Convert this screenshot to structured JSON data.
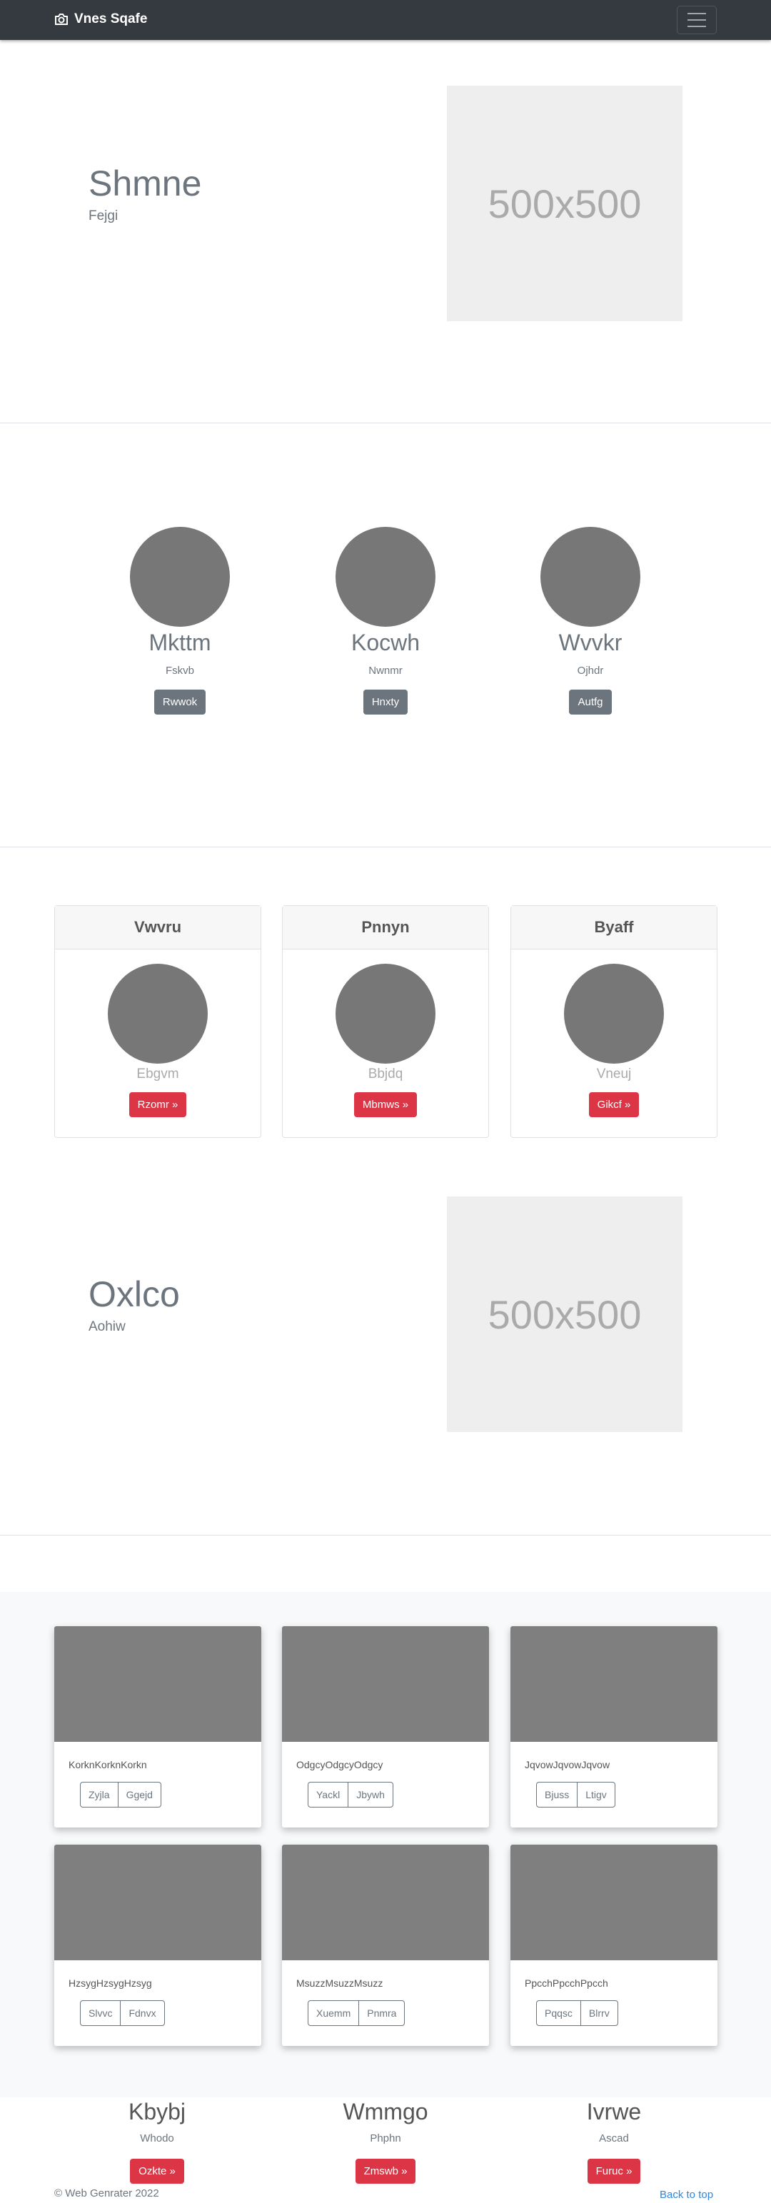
{
  "nav": {
    "brand": "Vnes Sqafe"
  },
  "hero1": {
    "title": "Shmne",
    "subtitle": "Fejgi",
    "image_label": "500x500"
  },
  "team": [
    {
      "name": "Mkttm",
      "role": "Fskvb",
      "button": "Rwwok"
    },
    {
      "name": "Kocwh",
      "role": "Nwnmr",
      "button": "Hnxty"
    },
    {
      "name": "Wvvkr",
      "role": "Ojhdr",
      "button": "Autfg"
    }
  ],
  "cards": [
    {
      "header": "Vwvru",
      "subtitle": "Ebgvm",
      "button": "Rzomr »"
    },
    {
      "header": "Pnnyn",
      "subtitle": "Bbjdq",
      "button": "Mbmws »"
    },
    {
      "header": "Byaff",
      "subtitle": "Vneuj",
      "button": "Gikcf »"
    }
  ],
  "hero2": {
    "title": "Oxlco",
    "subtitle": "Aohiw",
    "image_label": "500x500"
  },
  "album": [
    {
      "text": "KorknKorknKorkn",
      "btn1": "Zyjla",
      "btn2": "Ggejd"
    },
    {
      "text": "OdgcyOdgcyOdgcy",
      "btn1": "Yackl",
      "btn2": "Jbywh"
    },
    {
      "text": "JqvowJqvowJqvow",
      "btn1": "Bjuss",
      "btn2": "Ltigv"
    },
    {
      "text": "HzsygHzsygHzsyg",
      "btn1": "Slvvc",
      "btn2": "Fdnvx"
    },
    {
      "text": "MsuzzMsuzzMsuzz",
      "btn1": "Xuemm",
      "btn2": "Pnmra"
    },
    {
      "text": "PpcchPpcchPpcch",
      "btn1": "Pqqsc",
      "btn2": "Blrrv"
    }
  ],
  "marketing": [
    {
      "title": "Kbybj",
      "subtitle": "Whodo",
      "button": "Ozkte »"
    },
    {
      "title": "Wmmgo",
      "subtitle": "Phphn",
      "button": "Zmswb »"
    },
    {
      "title": "Ivrwe",
      "subtitle": "Ascad",
      "button": "Furuc »"
    }
  ],
  "footer": {
    "copyright": "© Web Genrater 2022",
    "back_to_top": "Back to top"
  },
  "colors": {
    "navbar": "#343a40",
    "accent_red": "#dc3545",
    "secondary": "#6c757d",
    "link": "#2e86de"
  }
}
